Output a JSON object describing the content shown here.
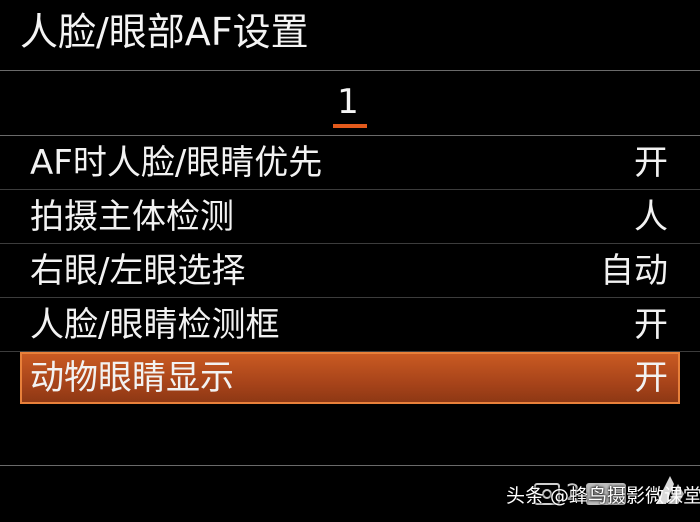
{
  "header": {
    "title": "人脸/眼部AF设置"
  },
  "page_indicator": {
    "current": "1"
  },
  "menu": {
    "items": [
      {
        "label": "AF时人脸/眼睛优先",
        "value": "开"
      },
      {
        "label": "拍摄主体检测",
        "value": "人"
      },
      {
        "label": "右眼/左眼选择",
        "value": "自动"
      },
      {
        "label": "人脸/眼睛检测框",
        "value": "开"
      },
      {
        "label": "动物眼睛显示",
        "value": "开",
        "selected": true
      }
    ]
  },
  "footer": {
    "page_number": "2",
    "icons": [
      "camera-icon",
      "return-icon"
    ]
  },
  "watermark": {
    "text": "头条 @蜂鸟摄影微课堂"
  },
  "colors": {
    "background": "#000000",
    "highlight": "#b44c1c",
    "highlight_border": "#e8803a",
    "page_underline": "#e35a1c",
    "text": "#f2f2f2"
  }
}
